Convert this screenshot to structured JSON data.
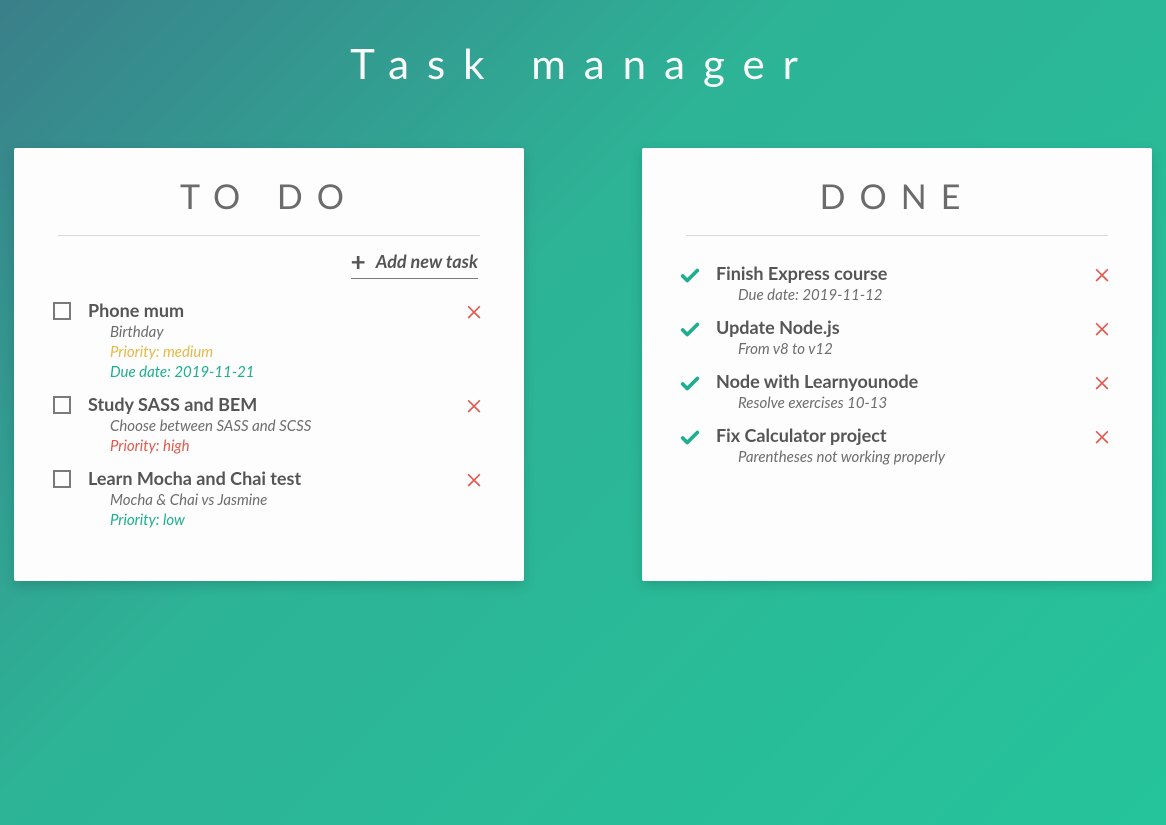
{
  "title": "Task manager",
  "colors": {
    "accent_teal": "#1fae8f",
    "danger_red": "#e05a4f",
    "warning_amber": "#e6b84a"
  },
  "columns": {
    "todo": {
      "heading": "TO DO",
      "addLabel": "Add new task",
      "items": [
        {
          "title": "Phone mum",
          "description": "Birthday",
          "priority_label": "Priority: medium",
          "priority_level": "medium",
          "due_label": "Due date: 2019-11-21",
          "due_style": "teal"
        },
        {
          "title": "Study SASS and BEM",
          "description": "Choose between SASS and SCSS",
          "priority_label": "Priority: high",
          "priority_level": "high"
        },
        {
          "title": "Learn Mocha and Chai test",
          "description": "Mocha & Chai vs Jasmine",
          "priority_label": "Priority: low",
          "priority_level": "low"
        }
      ]
    },
    "done": {
      "heading": "DONE",
      "items": [
        {
          "title": "Finish Express course",
          "description": "Due date: 2019-11-12"
        },
        {
          "title": "Update Node.js",
          "description": "From v8 to v12"
        },
        {
          "title": "Node with Learnyounode",
          "description": "Resolve exercises 10-13"
        },
        {
          "title": "Fix Calculator project",
          "description": "Parentheses not working properly"
        }
      ]
    }
  }
}
